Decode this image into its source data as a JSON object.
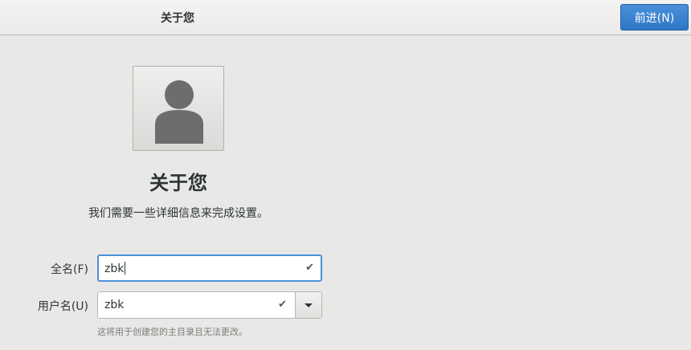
{
  "header": {
    "title": "关于您",
    "next_button_label": "前进(N)"
  },
  "main": {
    "title": "关于您",
    "subtitle": "我们需要一些详细信息来完成设置。"
  },
  "form": {
    "fullname": {
      "label": "全名(F)",
      "value": "zbk",
      "status_icon": "check-icon"
    },
    "username": {
      "label": "用户名(U)",
      "value": "zbk",
      "status_icon": "check-icon",
      "dropdown_icon": "chevron-down-icon"
    },
    "hint": "这将用于创建您的主目录且无法更改。"
  },
  "avatar": {
    "icon": "user-avatar-icon"
  },
  "colors": {
    "accent": "#4a90d9",
    "background": "#e8e8e7"
  }
}
